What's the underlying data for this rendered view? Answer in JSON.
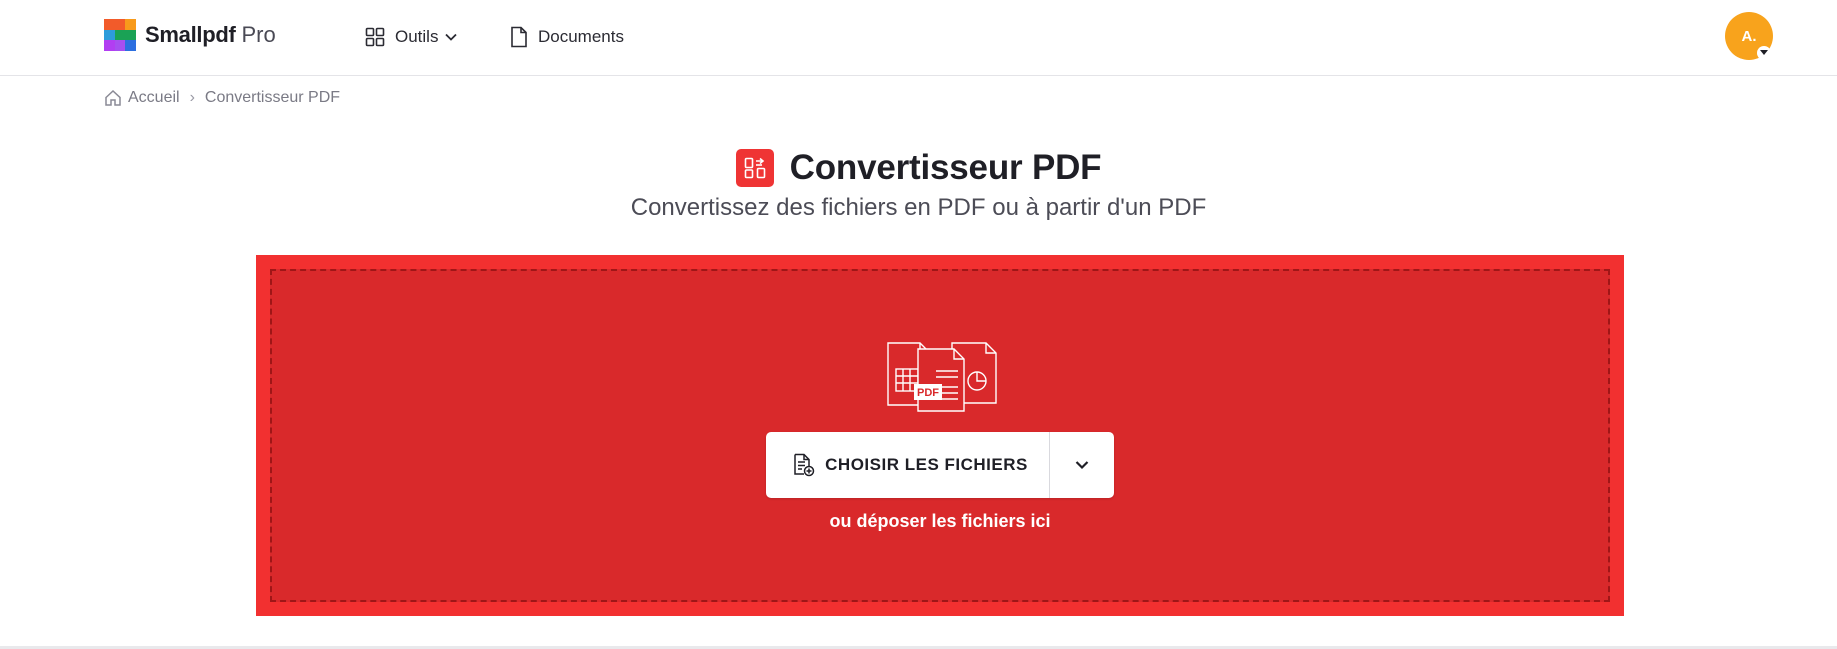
{
  "header": {
    "brand_name": "Smallpdf",
    "brand_tier": "Pro",
    "logo_colors": [
      "#f25b2a",
      "#f89a1b",
      "#1aa255",
      "#2d9cdb",
      "#1aa255",
      "#2c6fe0",
      "#b23ef2",
      "#a64ff0",
      "#2c6fe0"
    ],
    "nav": {
      "tools_label": "Outils",
      "documents_label": "Documents"
    },
    "avatar_initials": "A."
  },
  "breadcrumb": {
    "home_label": "Accueil",
    "separator": "›",
    "current_label": "Convertisseur PDF"
  },
  "hero": {
    "title": "Convertisseur PDF",
    "subtitle": "Convertissez des fichiers en PDF ou à partir d'un PDF"
  },
  "dropzone": {
    "choose_label": "CHOISIR LES FICHIERS",
    "hint": "ou déposer les fichiers ici",
    "graphic_badge": "PDF",
    "icons": [
      "spreadsheet-doc-icon",
      "pdf-doc-icon",
      "presentation-doc-icon"
    ]
  },
  "colors": {
    "accent_red": "#f23030",
    "dropzone_red": "#d9292b",
    "avatar_orange": "#f8a31c"
  }
}
